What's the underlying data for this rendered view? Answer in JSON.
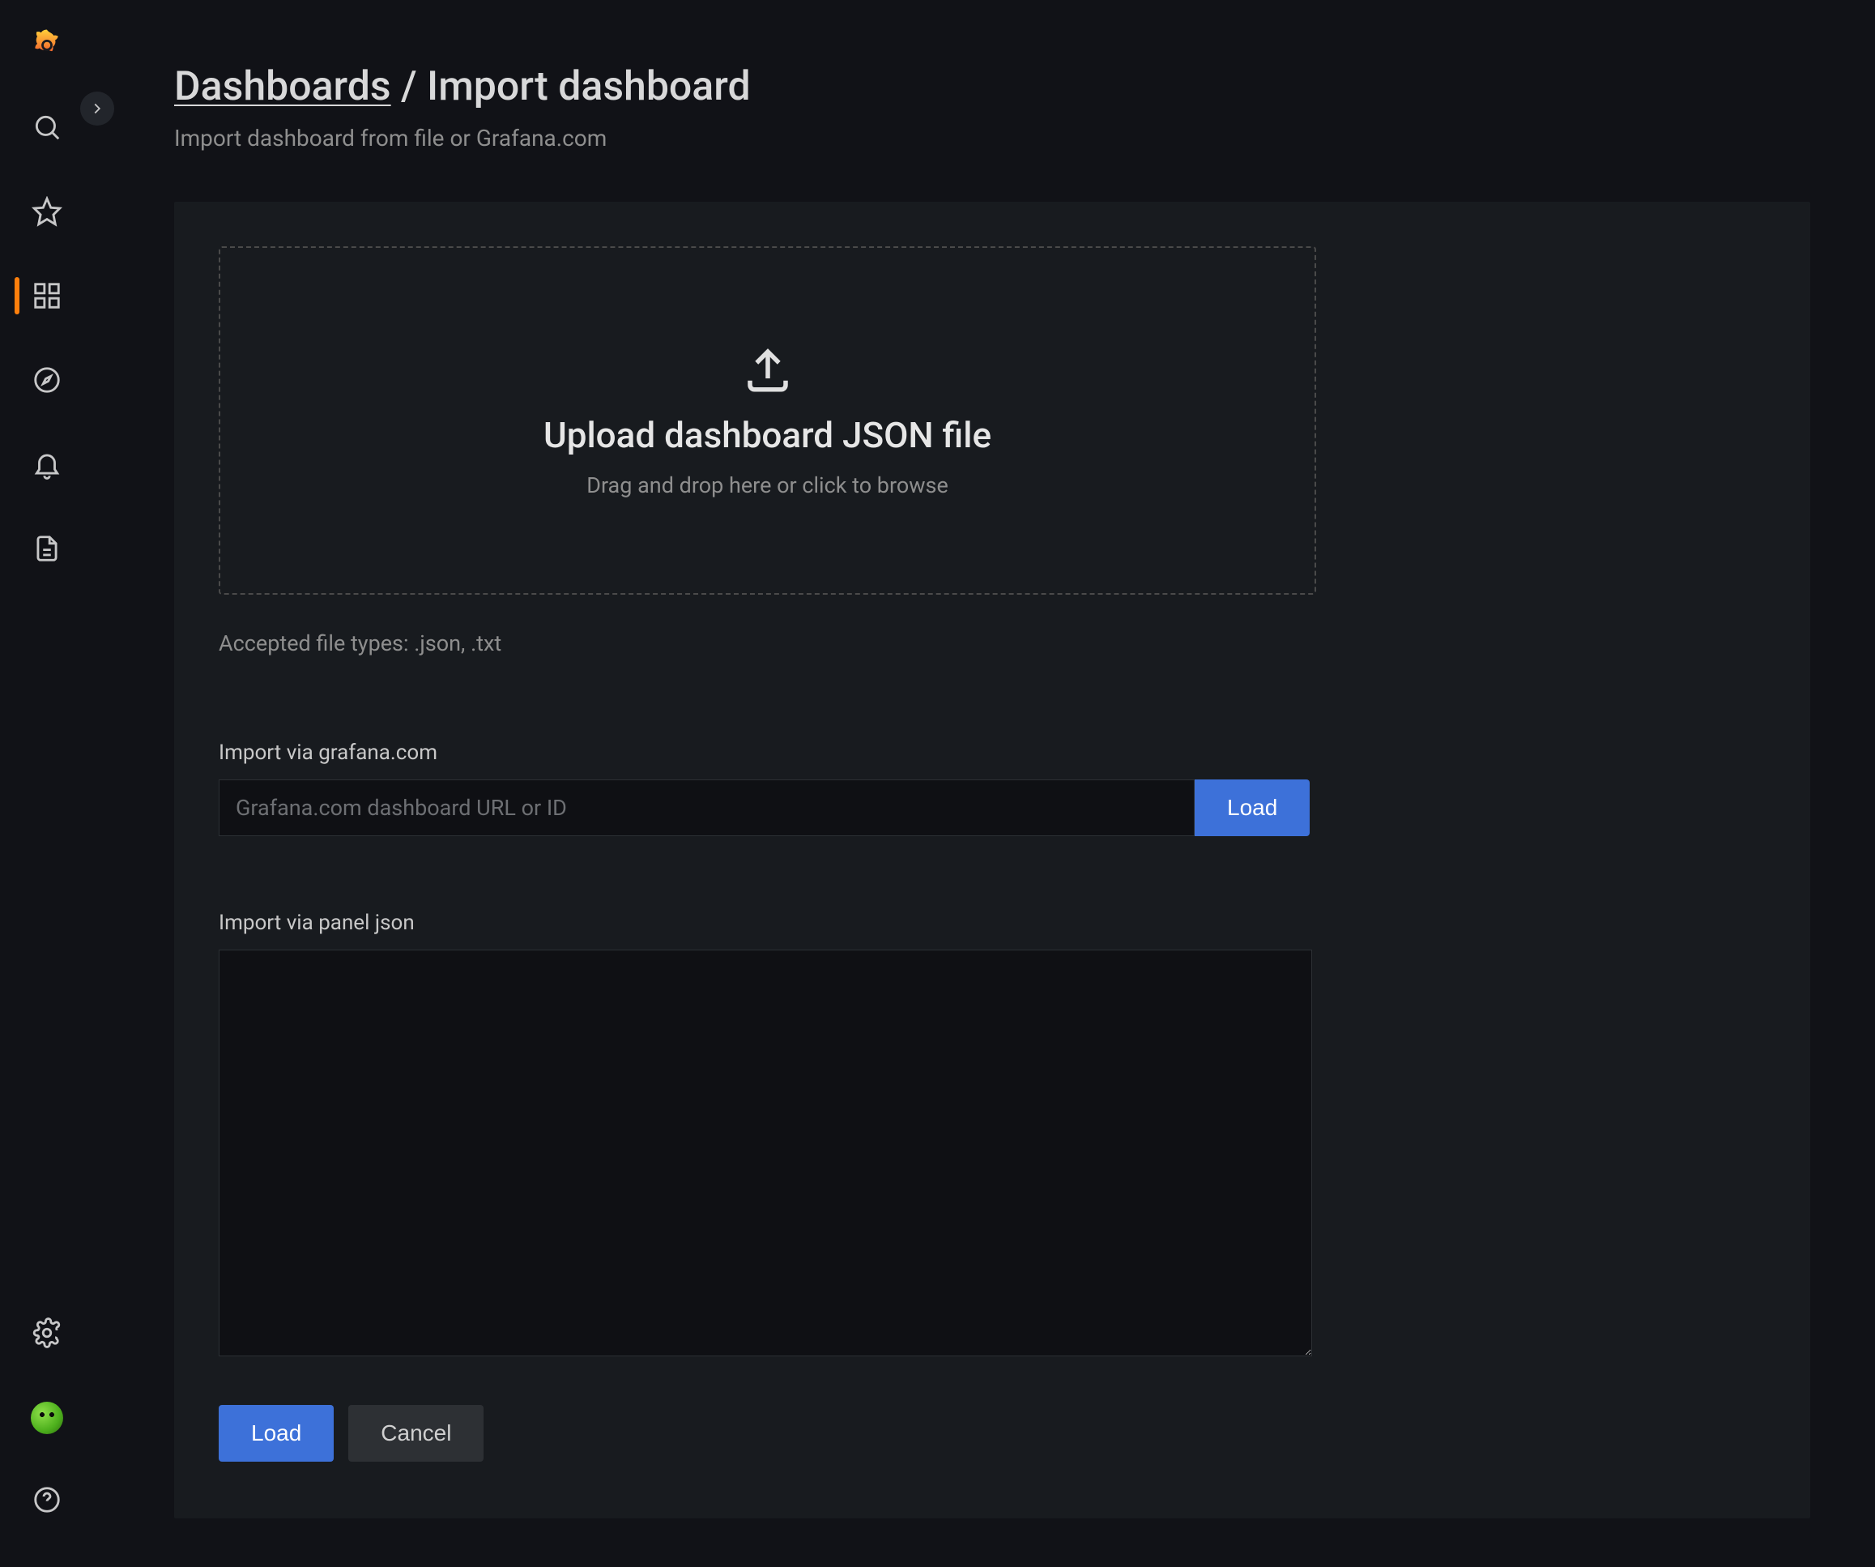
{
  "breadcrumb": {
    "parent": "Dashboards",
    "separator": " / ",
    "current": "Import dashboard"
  },
  "subtitle": "Import dashboard from file or Grafana.com",
  "dropzone": {
    "title": "Upload dashboard JSON file",
    "hint": "Drag and drop here or click to browse"
  },
  "accepted_label": "Accepted file types: .json, .txt",
  "via_url": {
    "label": "Import via grafana.com",
    "placeholder": "Grafana.com dashboard URL or ID",
    "button": "Load"
  },
  "via_json": {
    "label": "Import via panel json"
  },
  "actions": {
    "load": "Load",
    "cancel": "Cancel"
  },
  "sidebar": {
    "items": [
      {
        "name": "logo"
      },
      {
        "name": "search"
      },
      {
        "name": "starred"
      },
      {
        "name": "dashboards",
        "active": true
      },
      {
        "name": "explore"
      },
      {
        "name": "alerting"
      },
      {
        "name": "connections"
      }
    ],
    "bottom": [
      {
        "name": "settings"
      },
      {
        "name": "avatar"
      },
      {
        "name": "help"
      }
    ]
  }
}
